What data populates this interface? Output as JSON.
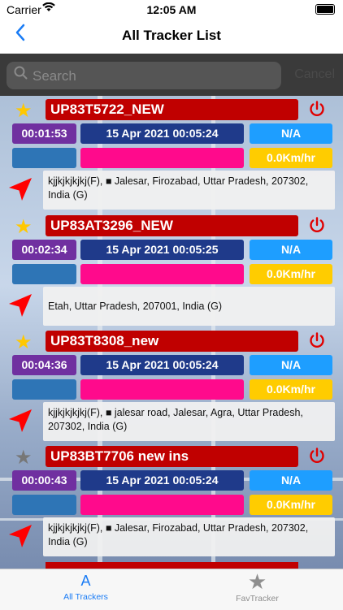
{
  "status_bar": {
    "carrier": "Carrier",
    "time": "12:05 AM"
  },
  "nav": {
    "title": "All Tracker List"
  },
  "search": {
    "placeholder": "Search",
    "cancel_label": "Cancel"
  },
  "trackers": [
    {
      "favorite": true,
      "name": "UP83T5722_NEW",
      "duration": "00:01:53",
      "datetime": "15 Apr 2021 00:05:24",
      "status": "N/A",
      "speed": "0.0Km/hr",
      "address": "kjjkjkjkjkj(F), ■ Jalesar, Firozabad, Uttar Pradesh, 207302, India (G)"
    },
    {
      "favorite": true,
      "name": "UP83AT3296_NEW",
      "duration": "00:02:34",
      "datetime": "15 Apr 2021 00:05:25",
      "status": "N/A",
      "speed": "0.0Km/hr",
      "address": "Etah, Uttar Pradesh, 207001, India (G)"
    },
    {
      "favorite": true,
      "name": "UP83T8308_new",
      "duration": "00:04:36",
      "datetime": "15 Apr 2021 00:05:24",
      "status": "N/A",
      "speed": "0.0Km/hr",
      "address": "kjjkjkjkjkj(F), ■ jalesar road, Jalesar, Agra, Uttar Pradesh, 207302, India (G)"
    },
    {
      "favorite": false,
      "name": "UP83BT7706 new ins",
      "duration": "00:00:43",
      "datetime": "15 Apr 2021 00:05:24",
      "status": "N/A",
      "speed": "0.0Km/hr",
      "address": "kjjkjkjkjkj(F), ■ Jalesar, Firozabad, Uttar Pradesh, 207302, India (G)"
    }
  ],
  "tabs": [
    {
      "label": "All Trackers",
      "icon": "A",
      "icon_name": "all-trackers-icon"
    },
    {
      "label": "FavTracker",
      "icon": "★",
      "icon_name": "star-icon"
    }
  ],
  "colors": {
    "plate": "#c00000",
    "duration": "#7030a0",
    "datetime": "#1f3a8a",
    "status": "#1e9eff",
    "speed": "#ffcc00",
    "pink": "#ff0a8c",
    "accent": "#1a7cf5"
  }
}
